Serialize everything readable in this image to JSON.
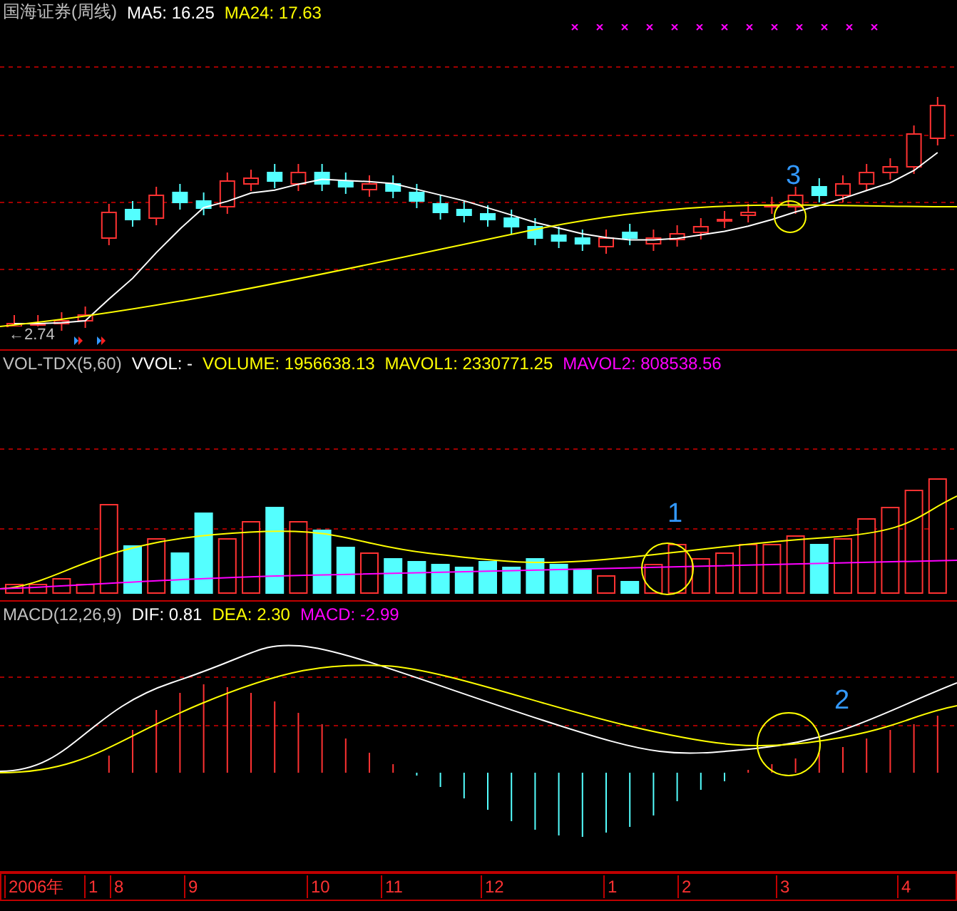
{
  "price_panel": {
    "legend": [
      {
        "text": "国海证券(周线)",
        "color": "#c0c0c0"
      },
      {
        "text": "MA5: 16.25",
        "color": "#ffffff"
      },
      {
        "text": "MA24: 17.63",
        "color": "#ffff00"
      }
    ],
    "low_label": "←2.74",
    "annotations": [
      {
        "text": "3"
      }
    ]
  },
  "volume_panel": {
    "legend": [
      {
        "text": "VOL-TDX(5,60)",
        "color": "#c0c0c0"
      },
      {
        "text": "VVOL: -",
        "color": "#ffffff"
      },
      {
        "text": "VOLUME: 1956638.13",
        "color": "#ffff00"
      },
      {
        "text": "MAVOL1: 2330771.25",
        "color": "#ffff00"
      },
      {
        "text": "MAVOL2: 808538.56",
        "color": "#ff00ff"
      }
    ],
    "annotations": [
      {
        "text": "1"
      }
    ]
  },
  "macd_panel": {
    "legend": [
      {
        "text": "MACD(12,26,9)",
        "color": "#c0c0c0"
      },
      {
        "text": "DIF: 0.81",
        "color": "#ffffff"
      },
      {
        "text": "DEA: 2.30",
        "color": "#ffff00"
      },
      {
        "text": "MACD: -2.99",
        "color": "#ff00ff"
      }
    ],
    "annotations": [
      {
        "text": "2"
      }
    ]
  },
  "time_axis": [
    "2006年",
    "1",
    "8",
    "9",
    "10",
    "11",
    "12",
    "1",
    "2",
    "3",
    "4"
  ]
}
